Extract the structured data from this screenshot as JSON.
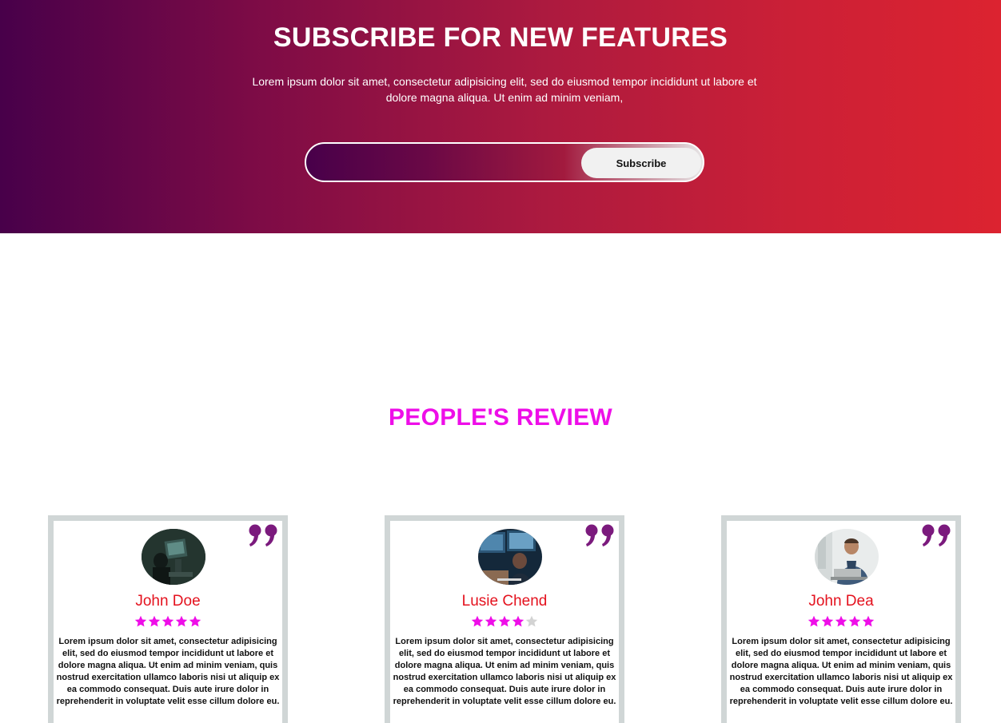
{
  "subscribe": {
    "title": "SUBSCRIBE FOR NEW FEATURES",
    "description": "Lorem ipsum dolor sit amet, consectetur adipisicing elit, sed do eiusmod tempor incididunt ut labore et dolore magna aliqua. Ut enim ad minim veniam,",
    "input_value": "",
    "button_label": "Subscribe"
  },
  "reviews": {
    "title": "PEOPLE'S REVIEW",
    "star_color": "#ee0ee8",
    "empty_star_color": "#d3d3d3",
    "name_color": "#e4121e",
    "quote_color": "#7b1a7d",
    "items": [
      {
        "name": "John Doe",
        "rating": 5,
        "avatar": "person-at-computer-dark-photo",
        "text": "Lorem ipsum dolor sit amet, consectetur adipisicing elit, sed do eiusmod tempor incididunt ut labore et dolore magna aliqua. Ut enim ad minim veniam, quis nostrud exercitation ullamco laboris nisi ut aliquip ex ea commodo consequat. Duis aute irure dolor in reprehenderit in voluptate velit esse cillum dolore eu."
      },
      {
        "name": "Lusie Chend",
        "rating": 4,
        "avatar": "person-at-monitors-photo",
        "text": "Lorem ipsum dolor sit amet, consectetur adipisicing elit, sed do eiusmod tempor incididunt ut labore et dolore magna aliqua. Ut enim ad minim veniam, quis nostrud exercitation ullamco laboris nisi ut aliquip ex ea commodo consequat. Duis aute irure dolor in reprehenderit in voluptate velit esse cillum dolore eu."
      },
      {
        "name": "John Dea",
        "rating": 5,
        "avatar": "man-with-laptop-photo",
        "text": "Lorem ipsum dolor sit amet, consectetur adipisicing elit, sed do eiusmod tempor incididunt ut labore et dolore magna aliqua. Ut enim ad minim veniam, quis nostrud exercitation ullamco laboris nisi ut aliquip ex ea commodo consequat. Duis aute irure dolor in reprehenderit in voluptate velit esse cillum dolore eu."
      }
    ]
  }
}
